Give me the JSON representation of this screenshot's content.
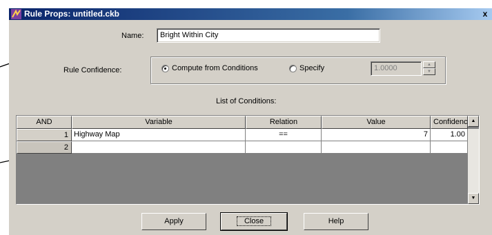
{
  "window": {
    "title": "Rule Props: untitled.ckb",
    "close_glyph": "x"
  },
  "name_field": {
    "label": "Name:",
    "value": "Bright Within City"
  },
  "confidence": {
    "label": "Rule Confidence:",
    "option_compute": "Compute from Conditions",
    "option_specify": "Specify",
    "selected": "compute",
    "specify_value": "1.0000"
  },
  "conditions": {
    "title": "List of Conditions:",
    "columns": [
      "AND",
      "Variable",
      "Relation",
      "Value",
      "Confidence"
    ],
    "rows": [
      {
        "num": "1",
        "variable": "Highway Map",
        "relation": "==",
        "value": "7",
        "confidence": "1.00"
      },
      {
        "num": "2",
        "variable": "",
        "relation": "",
        "value": "",
        "confidence": ""
      }
    ]
  },
  "buttons": {
    "apply": "Apply",
    "close": "Close",
    "help": "Help"
  }
}
